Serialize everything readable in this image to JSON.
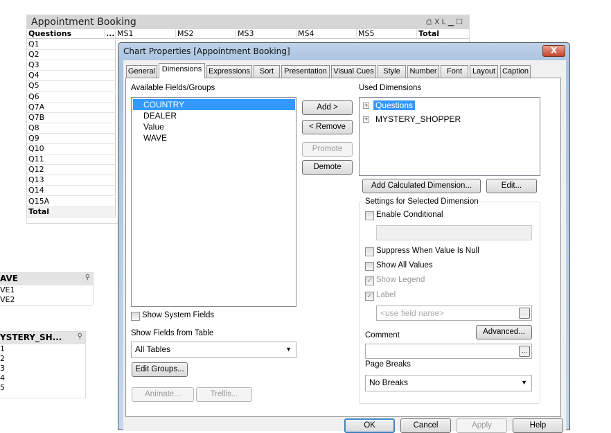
{
  "table": {
    "title": "Appointment Booking",
    "icons": "XL",
    "columns": [
      "Questions",
      "...",
      "MS1",
      "MS2",
      "MS3",
      "MS4",
      "MS5",
      "Total"
    ],
    "rows": [
      "Q1",
      "Q2",
      "Q3",
      "Q4",
      "Q5",
      "Q6",
      "Q7A",
      "Q7B",
      "Q8",
      "Q9",
      "Q10",
      "Q11",
      "Q12",
      "Q13",
      "Q14",
      "Q15A",
      "Total"
    ]
  },
  "listboxes": [
    {
      "title": "AVE",
      "items": [
        "VE1",
        "VE2"
      ]
    },
    {
      "title": "YSTERY_SH...",
      "items": [
        "1",
        "2",
        "3",
        "4",
        "5"
      ]
    }
  ],
  "dialog": {
    "title": "Chart Properties [Appointment Booking]",
    "close": "X",
    "tabs": [
      "General",
      "Dimensions",
      "Expressions",
      "Sort",
      "Presentation",
      "Visual Cues",
      "Style",
      "Number",
      "Font",
      "Layout",
      "Caption"
    ],
    "available_label": "Available Fields/Groups",
    "available": [
      "COUNTRY",
      "DEALER",
      "Value",
      "WAVE"
    ],
    "add": "Add >",
    "remove": "< Remove",
    "promote": "Promote",
    "demote": "Demote",
    "used_label": "Used Dimensions",
    "used": [
      "Questions",
      "MYSTERY_SHOPPER"
    ],
    "add_calc": "Add Calculated Dimension...",
    "edit": "Edit...",
    "settings_label": "Settings for Selected Dimension",
    "enable_conditional": "Enable Conditional",
    "suppress": "Suppress When Value Is Null",
    "show_all": "Show All Values",
    "show_legend": "Show Legend",
    "label": "Label",
    "label_placeholder": "<use field name>",
    "ellipsis": "...",
    "advanced": "Advanced...",
    "comment": "Comment",
    "page_breaks": "Page Breaks",
    "page_breaks_value": "No Breaks",
    "show_system": "Show System Fields",
    "show_from": "Show Fields from Table",
    "show_from_value": "All Tables",
    "edit_groups": "Edit Groups...",
    "animate": "Animate...",
    "trellis": "Trellis...",
    "ok": "OK",
    "cancel": "Cancel",
    "apply": "Apply",
    "help": "Help"
  }
}
